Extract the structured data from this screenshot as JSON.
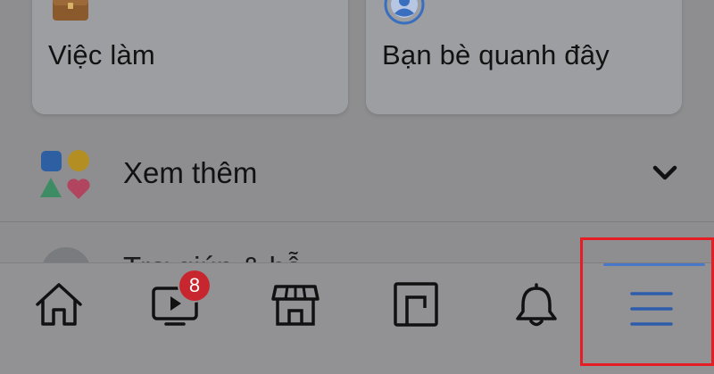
{
  "shortcuts": [
    {
      "label": "Việc làm",
      "icon": "briefcase-icon"
    },
    {
      "label": "Bạn bè quanh đây",
      "icon": "nearby-friends-icon"
    }
  ],
  "see_more": {
    "label": "Xem thêm",
    "icon": "apps-shapes-icon",
    "chevron": "chevron-down-icon"
  },
  "partial_row": {
    "label": "Trợ giúp & hỗ",
    "icon": "help-avatar-icon"
  },
  "tab_bar": {
    "tabs": [
      {
        "name": "home",
        "icon": "home-icon"
      },
      {
        "name": "watch",
        "icon": "video-icon",
        "badge": "8"
      },
      {
        "name": "marketplace",
        "icon": "store-icon"
      },
      {
        "name": "gaming",
        "icon": "gaming-icon"
      },
      {
        "name": "notifications",
        "icon": "bell-icon"
      },
      {
        "name": "menu",
        "icon": "hamburger-menu-icon",
        "active": true
      }
    ]
  },
  "colors": {
    "overlay_background": "#8e8e90",
    "badge": "#c8262e",
    "active_accent": "#4a78c8",
    "highlight_frame": "#e51d25"
  }
}
